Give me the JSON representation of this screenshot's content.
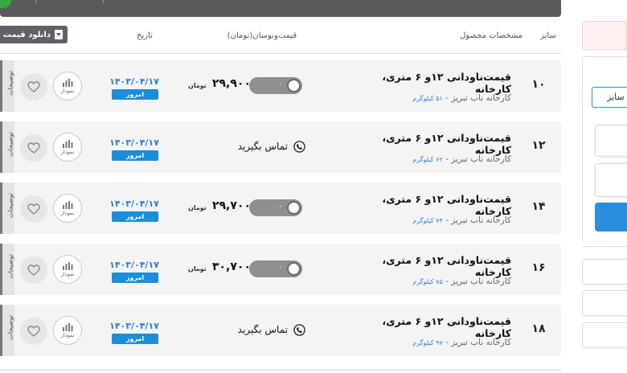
{
  "header": {
    "size": "سایز",
    "spec": "مشخصات محصول",
    "price": "قیمت‌ونوسان(تومان)",
    "date": "تاریخ",
    "download": "دانلود قیمت"
  },
  "rows": [
    {
      "size": "۱۰",
      "title": "قیمت‌ناودانی ۱۲و ۶ متری، کارخانه",
      "factory": "کارخانه ناب تبریز - ",
      "weight": "۵۱ کیلوگرم",
      "price": "۲۹,۹۰۰",
      "currency": "تومان",
      "change": "۰",
      "date": "۱۴۰۳/۰۴/۱۷",
      "today": "امروز",
      "chart": "نمودار",
      "notes": "توضیحات"
    },
    {
      "size": "۱۲",
      "title": "قیمت‌ناودانی ۱۲و ۶ متری، کارخانه",
      "factory": "کارخانه ناب تبریز - ",
      "weight": "۶۲ کیلوگرم",
      "contact": "تماس بگیرید",
      "date": "۱۴۰۳/۰۴/۱۷",
      "today": "امروز",
      "chart": "نمودار",
      "notes": "توضیحات"
    },
    {
      "size": "۱۴",
      "title": "قیمت‌ناودانی ۱۲و ۶ متری، کارخانه",
      "factory": "کارخانه ناب تبریز - ",
      "weight": "۷۴ کیلوگرم",
      "price": "۲۹,۷۰۰",
      "currency": "تومان",
      "change": "۰",
      "date": "۱۴۰۳/۰۴/۱۷",
      "today": "امروز",
      "chart": "نمودار",
      "notes": "توضیحات"
    },
    {
      "size": "۱۶",
      "title": "قیمت‌ناودانی ۱۲و ۶ متری، کارخانه",
      "factory": "کارخانه ناب تبریز - ",
      "weight": "۸۵ کیلوگرم",
      "price": "۳۰,۷۰۰",
      "currency": "تومان",
      "change": "۰",
      "date": "۱۴۰۳/۰۴/۱۷",
      "today": "امروز",
      "chart": "نمودار",
      "notes": "توضیحات"
    },
    {
      "size": "۱۸",
      "title": "قیمت‌ناودانی ۱۲و ۶ متری، کارخانه",
      "factory": "کارخانه ناب تبریز - ",
      "weight": "۹۷ کیلوگرم",
      "contact": "تماس بگیرید",
      "date": "۱۴۰۳/۰۴/۱۷",
      "today": "امروز",
      "chart": "نمودار",
      "notes": "توضیحات"
    }
  ],
  "right_panel": {
    "sort_label": "سایز"
  },
  "icons": {
    "download": "download-icon",
    "heart": "heart-icon",
    "chart": "bar-chart-icon",
    "phone": "phone-icon"
  },
  "colors": {
    "accent": "#1a8ed9",
    "date": "#2a7de0",
    "toggle": "#8f8f8f",
    "download_button": "#5d6268"
  }
}
